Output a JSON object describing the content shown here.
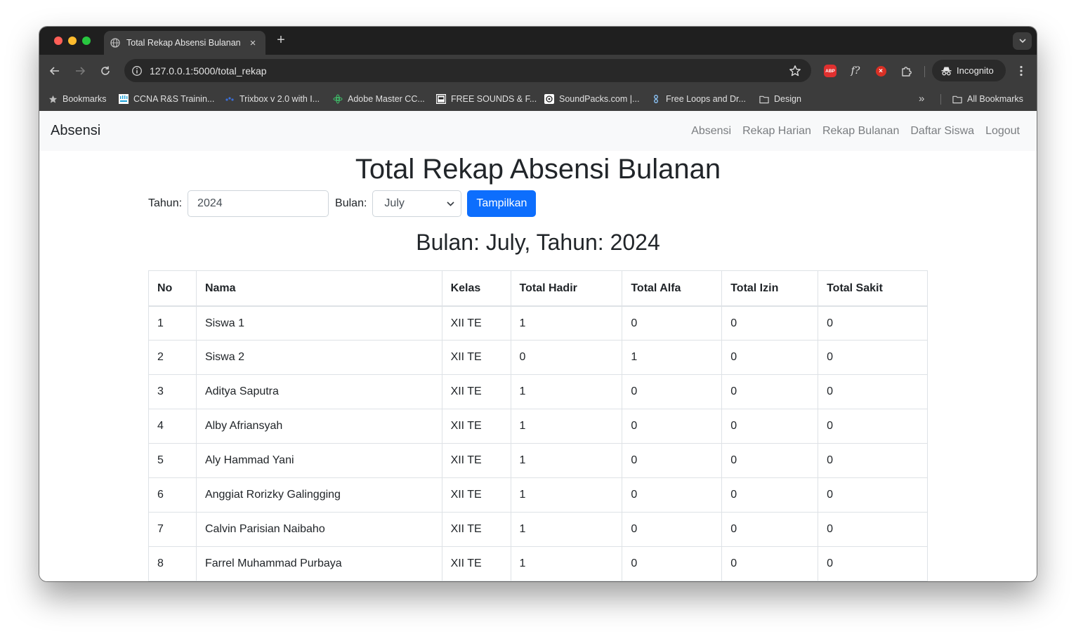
{
  "browser": {
    "tab_title": "Total Rekap Absensi Bulanan",
    "tab_close": "×",
    "new_tab": "+",
    "url": "127.0.0.1:5000/total_rekap",
    "incognito_label": "Incognito",
    "bookmarks_more": "»",
    "abp_label": "ABP",
    "fx_label": "f?",
    "x_label": "×",
    "bookmarks": [
      {
        "label": "Bookmarks",
        "icon": "star-icon"
      },
      {
        "label": "CCNA R&S Trainin...",
        "icon": "cisco-icon"
      },
      {
        "label": "Trixbox v 2.0 with I...",
        "icon": "trixbox-icon"
      },
      {
        "label": "Adobe Master CC...",
        "icon": "adobe-icon"
      },
      {
        "label": "FREE SOUNDS & F...",
        "icon": "sounds-icon"
      },
      {
        "label": "SoundPacks.com |...",
        "icon": "soundpacks-icon"
      },
      {
        "label": "Free Loops and Dr...",
        "icon": "loops-icon"
      },
      {
        "label": "Design",
        "icon": "folder-icon"
      }
    ],
    "all_bookmarks": "All Bookmarks"
  },
  "navbar": {
    "brand": "Absensi",
    "links": [
      "Absensi",
      "Rekap Harian",
      "Rekap Bulanan",
      "Daftar Siswa",
      "Logout"
    ]
  },
  "main": {
    "title": "Total Rekap Absensi Bulanan",
    "form": {
      "year_label": "Tahun:",
      "year_value": "2024",
      "month_label": "Bulan:",
      "month_value": "July",
      "submit_label": "Tampilkan"
    },
    "subtitle": "Bulan: July, Tahun: 2024",
    "table": {
      "headers": [
        "No",
        "Nama",
        "Kelas",
        "Total Hadir",
        "Total Alfa",
        "Total Izin",
        "Total Sakit"
      ],
      "rows": [
        [
          "1",
          "Siswa 1",
          "XII TE",
          "1",
          "0",
          "0",
          "0"
        ],
        [
          "2",
          "Siswa 2",
          "XII TE",
          "0",
          "1",
          "0",
          "0"
        ],
        [
          "3",
          "Aditya Saputra",
          "XII TE",
          "1",
          "0",
          "0",
          "0"
        ],
        [
          "4",
          "Alby Afriansyah",
          "XII TE",
          "1",
          "0",
          "0",
          "0"
        ],
        [
          "5",
          "Aly Hammad Yani",
          "XII TE",
          "1",
          "0",
          "0",
          "0"
        ],
        [
          "6",
          "Anggiat Rorizky Galingging",
          "XII TE",
          "1",
          "0",
          "0",
          "0"
        ],
        [
          "7",
          "Calvin Parisian Naibaho",
          "XII TE",
          "1",
          "0",
          "0",
          "0"
        ],
        [
          "8",
          "Farrel Muhammad Purbaya",
          "XII TE",
          "1",
          "0",
          "0",
          "0"
        ]
      ]
    }
  },
  "colors": {
    "primary_button": "#0d6efd",
    "navbar_bg": "#f8f9fa",
    "browser_dark": "#1f1f1f"
  }
}
